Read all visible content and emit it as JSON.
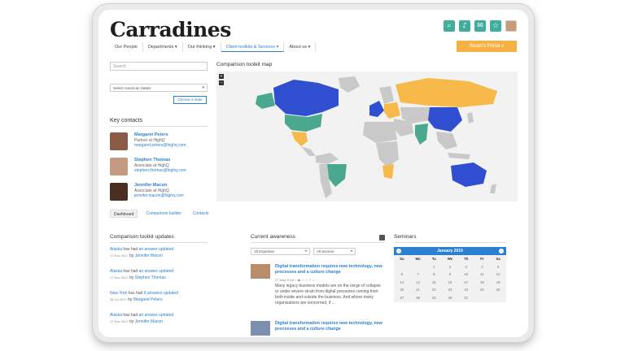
{
  "app": {
    "logo": "Carradines"
  },
  "header": {
    "icons": [
      "search-icon",
      "bell-icon",
      "mail-icon",
      "star-icon"
    ],
    "portal_button": "Stuart's Portal »"
  },
  "nav": [
    {
      "label": "Our People",
      "active": false
    },
    {
      "label": "Departments ▾",
      "active": false
    },
    {
      "label": "Our thinking ▾",
      "active": false
    },
    {
      "label": "Client toolkits & Services ▾",
      "active": true
    },
    {
      "label": "About us ▾",
      "active": false
    }
  ],
  "sidebar": {
    "search_placeholder": "Search",
    "state_select": "Select American States",
    "choose_button": "Choose a state",
    "key_contacts_title": "Key contacts",
    "contacts": [
      {
        "name": "Margaret Peters",
        "role": "Partner at HighQ",
        "email": "margaret.peters@highq.com",
        "color": "#8a5a44"
      },
      {
        "name": "Stephen Thomas",
        "role": "Associate at HighQ",
        "email": "stephen.thomas@highq.com",
        "color": "#c49b82"
      },
      {
        "name": "Jennifer Macon",
        "role": "Associate at HighQ",
        "email": "jennifer.macon@highq.com",
        "color": "#4a2e22"
      }
    ]
  },
  "map": {
    "title": "Comparison toolkit map",
    "zoom_in": "+",
    "zoom_out": "−",
    "colors": {
      "blue": "#2f4fd0",
      "green": "#4aa88e",
      "yellow": "#f6b94a",
      "gray": "#c9c9c9"
    }
  },
  "tabs": [
    {
      "label": "Dashboard",
      "active": true
    },
    {
      "label": "Comparison builder",
      "active": false
    },
    {
      "label": "Contacts",
      "active": false
    }
  ],
  "updates": {
    "title": "Comparison toolkit updates",
    "items": [
      {
        "subject": "Alaska",
        "verb": "has had",
        "link": "an answer updated",
        "date": "17 Nov 2017",
        "by": "by",
        "author": "Jennifer Macon"
      },
      {
        "subject": "Alaska",
        "verb": "has had",
        "link": "an answer updated",
        "date": "17 Nov 2017",
        "by": "by",
        "author": "Stephen Thomas"
      },
      {
        "subject": "New York",
        "verb": "has had",
        "link": "9 answers updated",
        "date": "26 Jul 2017",
        "by": "by",
        "author": "Margaret Peters"
      },
      {
        "subject": "Alaska",
        "verb": "has had",
        "link": "an answer updated",
        "date": "17 Nov 2017",
        "by": "by",
        "author": "Jennifer Macon"
      }
    ]
  },
  "awareness": {
    "title": "Current awareness",
    "filter_expertise": "All Expertise",
    "filter_sectors": "All Sectors",
    "articles": [
      {
        "title": "Digital transformation requires new technology, new processes and a culture change",
        "date": "27 May 2018",
        "excerpt": "Many legacy business models are on the verge of collapse or under severe strain from digital pressures coming from both inside and outside the business. And where many organisations are concerned, if ..."
      },
      {
        "title": "Digital transformation requires new technology, new processes and a culture change",
        "date": "",
        "excerpt": ""
      }
    ]
  },
  "seminars": {
    "title": "Seminars",
    "month": "January 2019",
    "dow": [
      "Su",
      "Mo",
      "Tu",
      "We",
      "Th",
      "Fr",
      "Sa"
    ],
    "days": [
      "",
      "",
      "1",
      "2",
      "3",
      "4",
      "5",
      "6",
      "7",
      "8",
      "9",
      "10",
      "11",
      "12",
      "13",
      "14",
      "15",
      "16",
      "17",
      "18",
      "19",
      "20",
      "21",
      "22",
      "23",
      "24",
      "25",
      "26",
      "27",
      "28",
      "29",
      "30",
      "31",
      "",
      ""
    ]
  }
}
